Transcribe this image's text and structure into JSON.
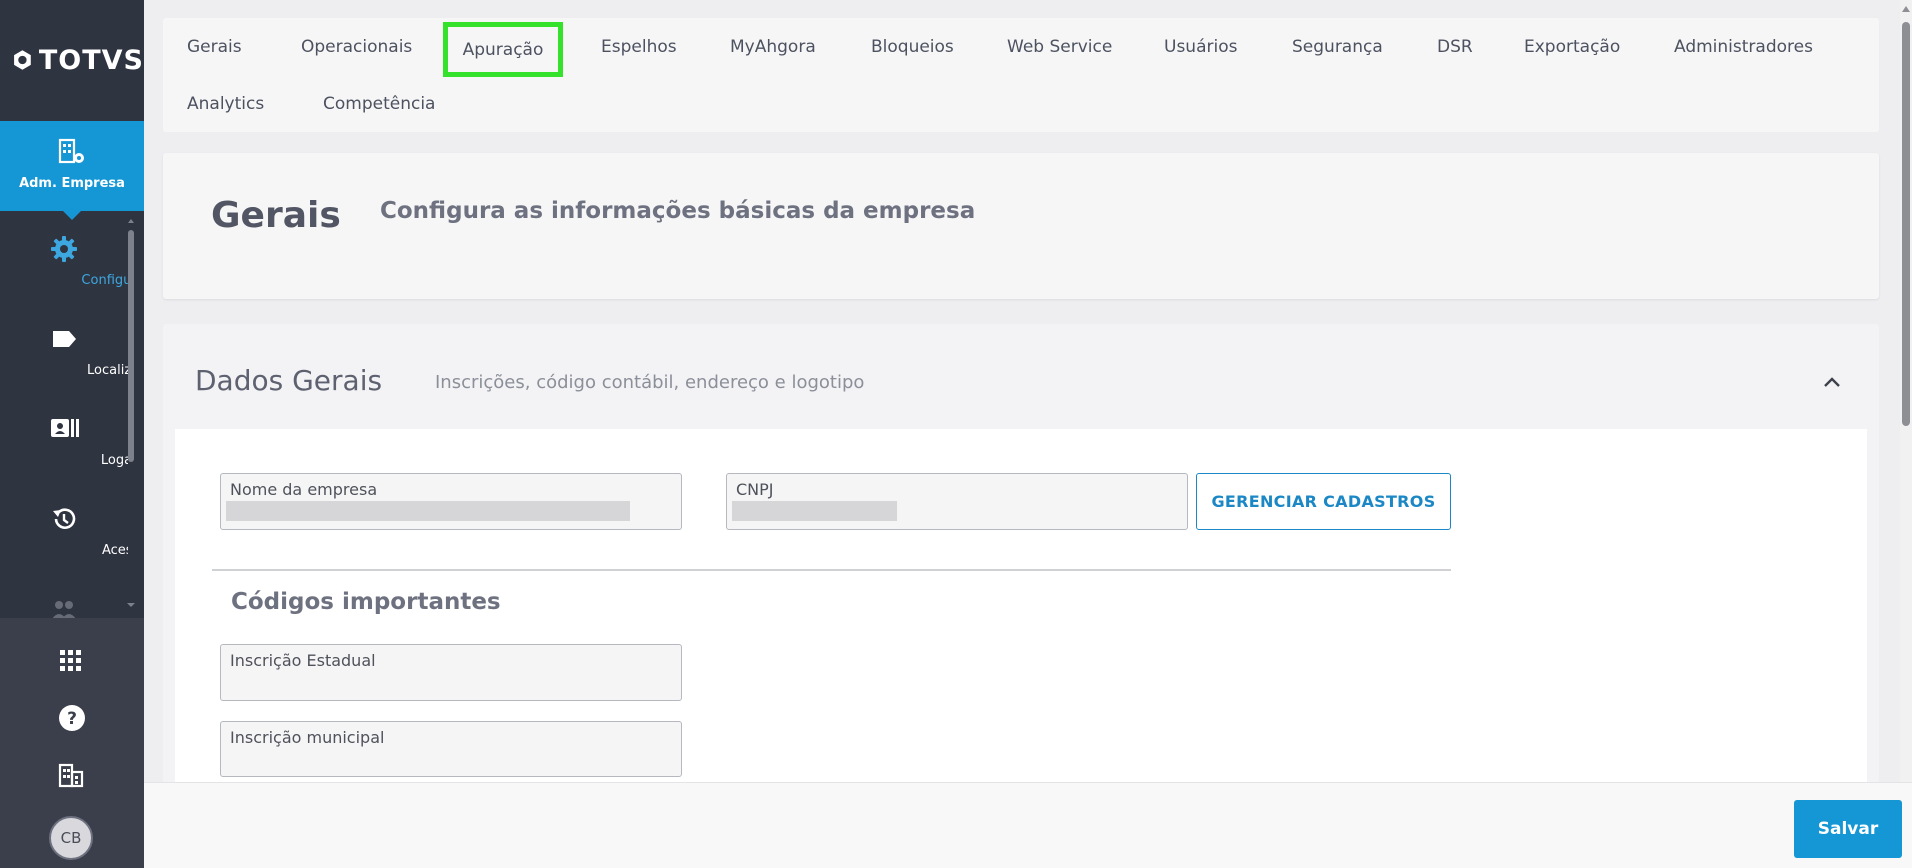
{
  "brand": {
    "name": "TOTVS"
  },
  "sidebar": {
    "active": {
      "label": "Adm. Empresa",
      "icon": "building-gear-icon"
    },
    "items": [
      {
        "label": "Configurações",
        "icon": "gear-icon",
        "selected": true
      },
      {
        "label": "Localizações",
        "icon": "tag-icon"
      },
      {
        "label": "Logados",
        "icon": "id-card-icon"
      },
      {
        "label": "Acessos",
        "icon": "history-icon"
      }
    ],
    "bottom": {
      "apps_icon": "apps-grid-icon",
      "help_icon": "help-icon",
      "company_icon": "building-icon",
      "avatar_initials": "CB"
    }
  },
  "tabs": [
    {
      "label": "Gerais"
    },
    {
      "label": "Operacionais"
    },
    {
      "label": "Apuração",
      "highlighted": true
    },
    {
      "label": "Espelhos"
    },
    {
      "label": "MyAhgora"
    },
    {
      "label": "Bloqueios"
    },
    {
      "label": "Web Service"
    },
    {
      "label": "Usuários"
    },
    {
      "label": "Segurança"
    },
    {
      "label": "DSR"
    },
    {
      "label": "Exportação"
    },
    {
      "label": "Administradores"
    },
    {
      "label": "Analytics"
    },
    {
      "label": "Competência"
    }
  ],
  "header": {
    "title": "Gerais",
    "description": "Configura as informações básicas da empresa"
  },
  "section": {
    "title": "Dados Gerais",
    "subtitle": "Inscrições, código contábil, endereço e logotipo",
    "fields": {
      "company_name_label": "Nome da empresa",
      "cnpj_label": "CNPJ",
      "manage_button": "GERENCIAR CADASTROS",
      "codes_heading": "Códigos importantes",
      "state_registration_label": "Inscrição Estadual",
      "municipal_registration_label": "Inscrição municipal"
    }
  },
  "footer": {
    "save_label": "Salvar"
  },
  "colors": {
    "accent": "#1497d4",
    "sidebar_bg": "#2f3441",
    "highlight_outline": "#34e12b"
  }
}
